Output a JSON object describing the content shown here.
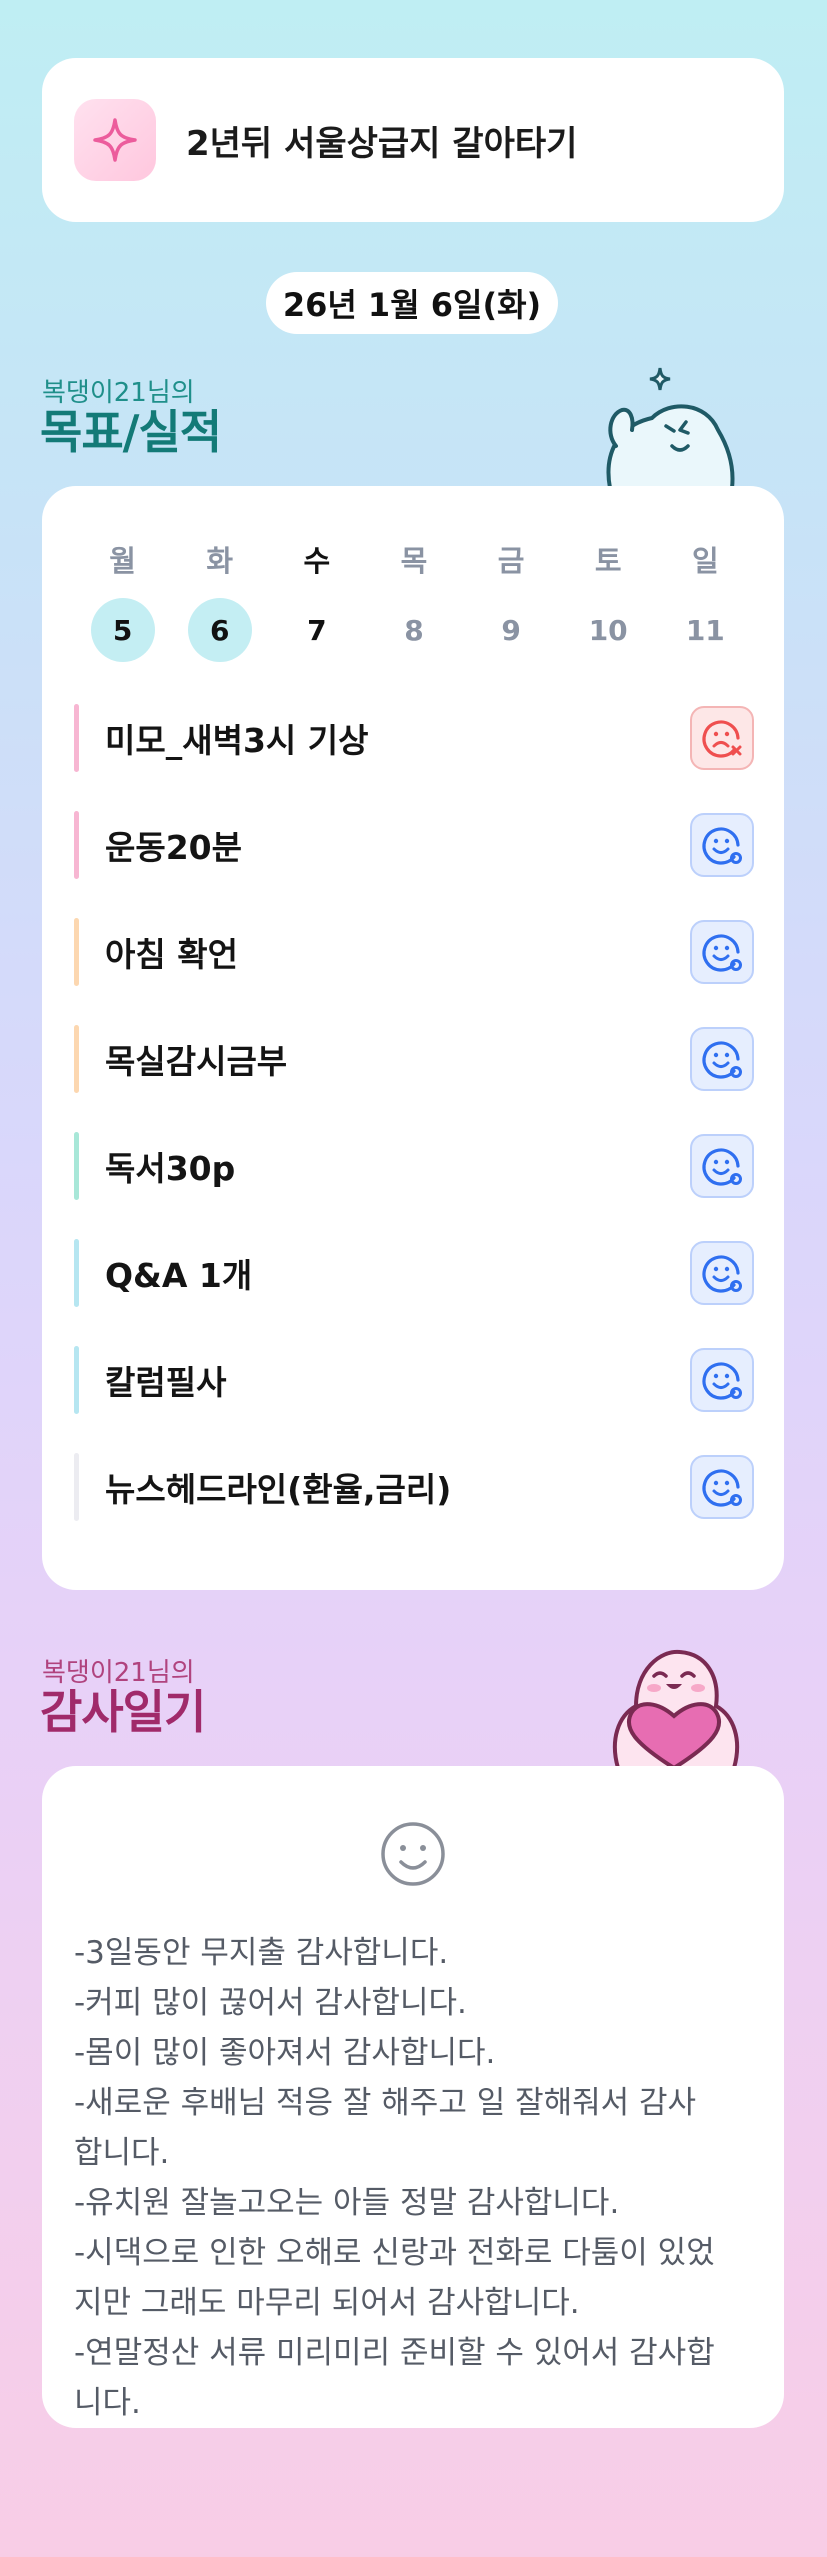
{
  "goal": {
    "icon": "sparkle-icon",
    "title": "2년뒤 서울상급지 갈아타기"
  },
  "date": "26년 1월 6일(화)",
  "goals_section": {
    "subtitle": "복댕이21님의",
    "title": "목표/실적"
  },
  "week": [
    {
      "name": "월",
      "num": "5",
      "state": "done"
    },
    {
      "name": "화",
      "num": "6",
      "state": "done"
    },
    {
      "name": "수",
      "num": "7",
      "state": "today"
    },
    {
      "name": "목",
      "num": "8",
      "state": "future"
    },
    {
      "name": "금",
      "num": "9",
      "state": "future"
    },
    {
      "name": "토",
      "num": "10",
      "state": "future"
    },
    {
      "name": "일",
      "num": "11",
      "state": "future"
    }
  ],
  "tasks": [
    {
      "label": "미모_새벽3시 기상",
      "status": "fail",
      "bar_color": "#f7b6d2"
    },
    {
      "label": "운동20분",
      "status": "ok",
      "bar_color": "#f7b6d2"
    },
    {
      "label": "아침 확언",
      "status": "ok",
      "bar_color": "#fcd7b0"
    },
    {
      "label": "목실감시금부",
      "status": "ok",
      "bar_color": "#fcd7b0"
    },
    {
      "label": "독서30p",
      "status": "ok",
      "bar_color": "#a8e7d8"
    },
    {
      "label": "Q&A 1개",
      "status": "ok",
      "bar_color": "#b6e6f1"
    },
    {
      "label": "칼럼필사",
      "status": "ok",
      "bar_color": "#b6e6f1"
    },
    {
      "label": "뉴스헤드라인(환율,금리)",
      "status": "ok",
      "bar_color": "#ececf1"
    }
  ],
  "thanks_section": {
    "subtitle": "복댕이21님의",
    "title": "감사일기"
  },
  "thanks_lines": [
    "-3일동안 무지출 감사합니다.",
    "-커피 많이 끊어서 감사합니다.",
    "-몸이 많이 좋아져서 감사합니다.",
    "-새로운 후배님 적응 잘 해주고 일 잘해줘서 감사",
    "합니다.",
    "-유치원 잘놀고오는 아들 정말 감사합니다.",
    "-시댁으로 인한 오해로 신랑과 전화로 다툼이 있었",
    "지만 그래도 마무리 되어서 감사합니다.",
    "-연말정산 서류 미리미리 준비할 수 있어서 감사합",
    "니다."
  ],
  "colors": {
    "done_day_bg": "#c4eef3",
    "ok_icon": "#2f6ff0",
    "fail_icon": "#ef4f4f"
  }
}
